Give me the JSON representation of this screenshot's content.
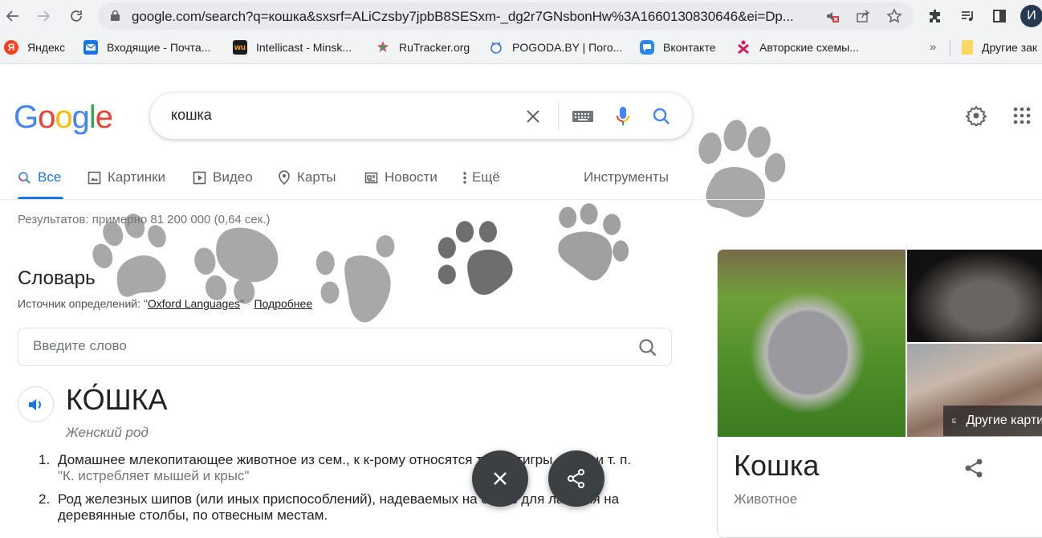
{
  "browser": {
    "url": "google.com/search?q=кошка&sxsrf=ALiCzsby7jpbB8SESxm-_dg2r7GNsbonHw%3A1660130830646&ei=Dp...",
    "avatar_letter": "И",
    "icons": [
      "back-icon",
      "forward-icon",
      "reload-icon",
      "lock-icon",
      "blocked-sound-icon",
      "share-icon",
      "star-icon",
      "extensions-icon",
      "media-icon",
      "side-panel-icon"
    ]
  },
  "bookmarks": {
    "items": [
      {
        "label": "Яндекс",
        "icon": "yandex-icon",
        "color": "#fc3f1d"
      },
      {
        "label": "Входящие - Почта...",
        "icon": "mail-icon",
        "color": "#1a73e8"
      },
      {
        "label": "Intellicast - Minsk...",
        "icon": "wu-icon",
        "color": "#1c1c1c"
      },
      {
        "label": "RuTracker.org",
        "icon": "rutracker-icon",
        "color": "#e0467d"
      },
      {
        "label": "POGODA.BY | Пого...",
        "icon": "pogoda-icon",
        "color": "#3b78d8"
      },
      {
        "label": "Вконтакте",
        "icon": "vk-icon",
        "color": "#2787f5"
      },
      {
        "label": "Авторские схемы...",
        "icon": "schemes-icon",
        "color": "#d81b60"
      }
    ],
    "overflow": "»",
    "other_folder": "Другие зак"
  },
  "search": {
    "logo": "Google",
    "query": "кошка"
  },
  "tabs": [
    {
      "label": "Все",
      "icon": "search-icon",
      "active": true
    },
    {
      "label": "Картинки",
      "icon": "image-icon",
      "active": false
    },
    {
      "label": "Видео",
      "icon": "video-icon",
      "active": false
    },
    {
      "label": "Карты",
      "icon": "map-pin-icon",
      "active": false
    },
    {
      "label": "Новости",
      "icon": "news-icon",
      "active": false
    },
    {
      "label": "Ещё",
      "icon": "more-vert-icon",
      "active": false
    }
  ],
  "tools_label": "Инструменты",
  "result_stats": "Результатов: примерно 81 200 000 (0,64 сек.)",
  "dictionary": {
    "title": "Словарь",
    "source_prefix": "Источник определений: \"",
    "source_link": "Oxford Languages",
    "source_suffix": "\"",
    "separator": " · ",
    "more_link": "Подробнее",
    "input_placeholder": "Введите слово",
    "headword": "КО́ШКА",
    "gender": "Женский род",
    "definitions": [
      {
        "num": "1.",
        "text": "Домашнее млекопитающее животное из сем., к к-рому относятся также тигры, львы и т. п.",
        "example": "\"К. истребляет мышей и крыс\""
      },
      {
        "num": "2.",
        "text": "Род железных шипов (или иных приспособлений), надеваемых на обувь для лазания на деревянные столбы, по отвесным местам.",
        "example": ""
      }
    ]
  },
  "knowledge_panel": {
    "title": "Кошка",
    "subtitle": "Животное",
    "more_images": "Другие картинки"
  },
  "fabs": [
    {
      "name": "close",
      "icon": "close-icon"
    },
    {
      "name": "share",
      "icon": "share-icon"
    }
  ]
}
